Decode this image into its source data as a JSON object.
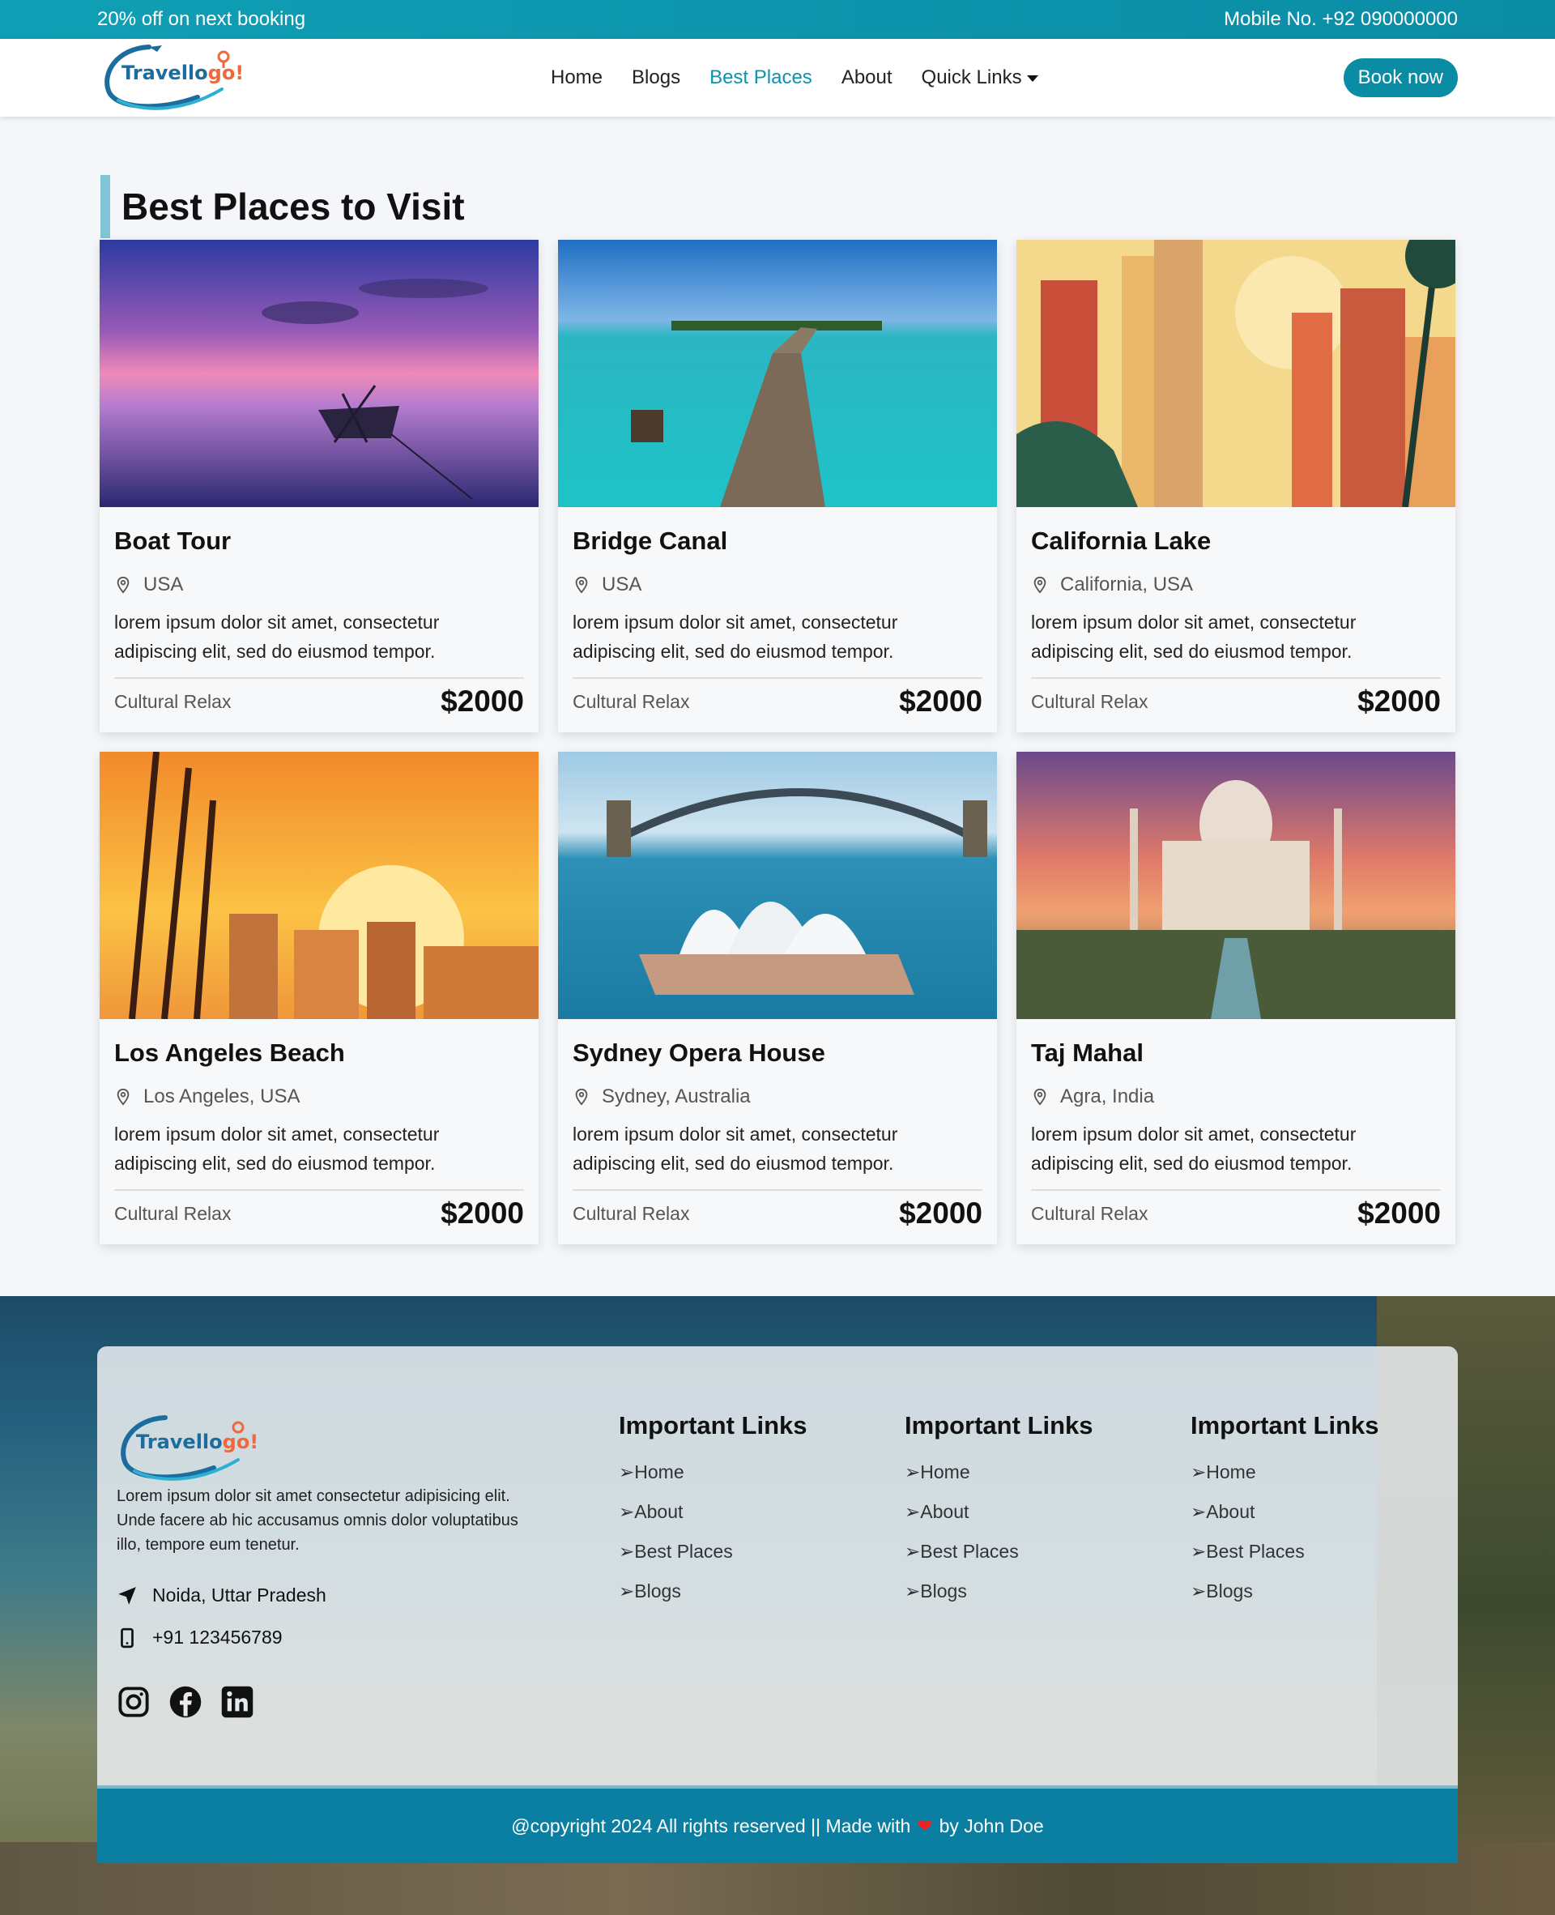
{
  "topbar": {
    "promo": "20% off on next booking",
    "mobile": "Mobile No. +92 090000000"
  },
  "nav": {
    "logo_text_a": "Travello",
    "logo_text_b": "go!",
    "links": [
      "Home",
      "Blogs",
      "Best Places",
      "About",
      "Quick Links"
    ],
    "active": "Best Places",
    "cta": "Book now"
  },
  "section": {
    "title": "Best Places to Visit"
  },
  "cards": [
    {
      "title": "Boat Tour",
      "location": "USA",
      "desc": "lorem ipsum dolor sit amet, consectetur adipiscing elit, sed do eiusmod tempor.",
      "category": "Cultural Relax",
      "price": "$2000",
      "image": "sunset-lake-boat"
    },
    {
      "title": "Bridge Canal",
      "location": "USA",
      "desc": "lorem ipsum dolor sit amet, consectetur adipiscing elit, sed do eiusmod tempor.",
      "category": "Cultural Relax",
      "price": "$2000",
      "image": "pier-turquoise-water"
    },
    {
      "title": "California Lake",
      "location": "California, USA",
      "desc": "lorem ipsum dolor sit amet, consectetur adipiscing elit, sed do eiusmod tempor.",
      "category": "Cultural Relax",
      "price": "$2000",
      "image": "city-palms-illustration"
    },
    {
      "title": "Los Angeles Beach",
      "location": "Los Angeles, USA",
      "desc": "lorem ipsum dolor sit amet, consectetur adipiscing elit, sed do eiusmod tempor.",
      "category": "Cultural Relax",
      "price": "$2000",
      "image": "sunset-city-illustration"
    },
    {
      "title": "Sydney Opera House",
      "location": "Sydney, Australia",
      "desc": "lorem ipsum dolor sit amet, consectetur adipiscing elit, sed do eiusmod tempor.",
      "category": "Cultural Relax",
      "price": "$2000",
      "image": "opera-house-harbour"
    },
    {
      "title": "Taj Mahal",
      "location": "Agra, India",
      "desc": "lorem ipsum dolor sit amet, consectetur adipiscing elit, sed do eiusmod tempor.",
      "category": "Cultural Relax",
      "price": "$2000",
      "image": "taj-mahal-sunset"
    }
  ],
  "footer": {
    "about": "Lorem ipsum dolor sit amet consectetur adipisicing elit. Unde facere ab hic accusamus omnis dolor voluptatibus illo, tempore eum tenetur.",
    "address": "Noida, Uttar Pradesh",
    "phone": "+91 123456789",
    "social": [
      "instagram-icon",
      "facebook-icon",
      "linkedin-icon"
    ],
    "columns": [
      {
        "title": "Important Links",
        "links": [
          "Home",
          "About",
          "Best Places",
          "Blogs"
        ]
      },
      {
        "title": "Important Links",
        "links": [
          "Home",
          "About",
          "Best Places",
          "Blogs"
        ]
      },
      {
        "title": "Important Links",
        "links": [
          "Home",
          "About",
          "Best Places",
          "Blogs"
        ]
      }
    ],
    "copyright_a": "@copyright 2024 All rights reserved || Made with",
    "copyright_b": "by John Doe"
  },
  "colors": {
    "accent": "#0b8ca5",
    "title_bar": "#80c4d6",
    "active_link": "#0d93ad"
  }
}
